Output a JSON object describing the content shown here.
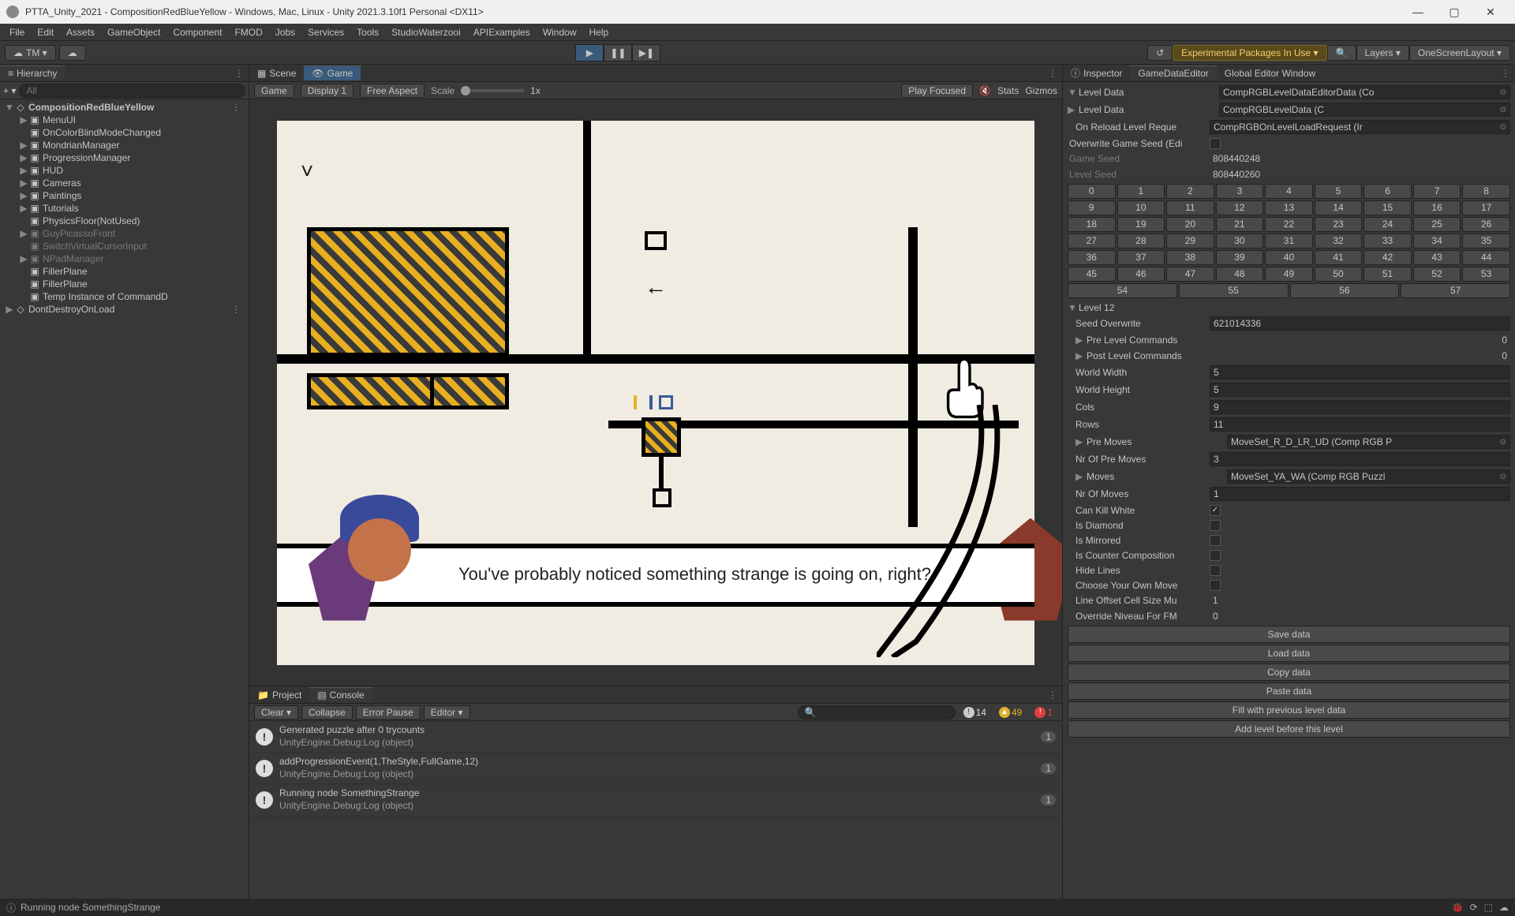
{
  "window": {
    "title": "PTTA_Unity_2021 - CompositionRedBlueYellow - Windows, Mac, Linux - Unity 2021.3.10f1 Personal <DX11>"
  },
  "menubar": [
    "File",
    "Edit",
    "Assets",
    "GameObject",
    "Component",
    "FMOD",
    "Jobs",
    "Services",
    "Tools",
    "StudioWaterzooi",
    "APIExamples",
    "Window",
    "Help"
  ],
  "toolbar": {
    "account": "TM ▾",
    "experimental": "Experimental Packages In Use ▾",
    "layers": "Layers",
    "layout": "OneScreenLayout ▾"
  },
  "hierarchy": {
    "tab": "Hierarchy",
    "search_ph": "All",
    "plus": "+ ▾",
    "items": [
      {
        "label": "CompositionRedBlueYellow",
        "depth": 0,
        "arrow": "▼",
        "bold": true,
        "ctx": true
      },
      {
        "label": "MenuUI",
        "depth": 1,
        "arrow": "▶"
      },
      {
        "label": "OnColorBlindModeChanged",
        "depth": 1,
        "arrow": ""
      },
      {
        "label": "MondrianManager",
        "depth": 1,
        "arrow": "▶"
      },
      {
        "label": "ProgressionManager",
        "depth": 1,
        "arrow": "▶"
      },
      {
        "label": "HUD",
        "depth": 1,
        "arrow": "▶"
      },
      {
        "label": "Cameras",
        "depth": 1,
        "arrow": "▶"
      },
      {
        "label": "Paintings",
        "depth": 1,
        "arrow": "▶"
      },
      {
        "label": "Tutorials",
        "depth": 1,
        "arrow": "▶"
      },
      {
        "label": "PhysicsFloor(NotUsed)",
        "depth": 1,
        "arrow": ""
      },
      {
        "label": "GuyPicassoFront",
        "depth": 1,
        "arrow": "▶",
        "dim": true
      },
      {
        "label": "SwitchVirtualCursorInput",
        "depth": 1,
        "arrow": "",
        "dim": true
      },
      {
        "label": "NPadManager",
        "depth": 1,
        "arrow": "▶",
        "dim": true
      },
      {
        "label": "FillerPlane",
        "depth": 1,
        "arrow": ""
      },
      {
        "label": "FillerPlane",
        "depth": 1,
        "arrow": ""
      },
      {
        "label": "Temp Instance of CommandD",
        "depth": 1,
        "arrow": ""
      },
      {
        "label": "DontDestroyOnLoad",
        "depth": 0,
        "arrow": "▶",
        "bold": false,
        "ctx": true
      }
    ]
  },
  "scenetabs": {
    "scene": "Scene",
    "game": "Game"
  },
  "gametoolbar": {
    "mode": "Game",
    "display": "Display 1",
    "aspect": "Free Aspect",
    "scale": "Scale",
    "scaleval": "1x",
    "playfocused": "Play Focused",
    "stats": "Stats",
    "gizmos": "Gizmos"
  },
  "dialogue": "You've probably noticed something strange is going on, right?",
  "console": {
    "tabs": {
      "project": "Project",
      "console": "Console"
    },
    "buttons": {
      "clear": "Clear ▾",
      "collapse": "Collapse",
      "errorpause": "Error Pause",
      "editor": "Editor ▾"
    },
    "counts": {
      "info": "14",
      "warn": "49",
      "err": "1"
    },
    "logs": [
      {
        "line1": "Generated puzzle after 0 trycounts",
        "line2": "UnityEngine.Debug:Log (object)",
        "count": "1"
      },
      {
        "line1": "addProgressionEvent(1,TheStyle,FullGame,12)",
        "line2": "UnityEngine.Debug:Log (object)",
        "count": "1"
      },
      {
        "line1": "Running node SomethingStrange",
        "line2": "UnityEngine.Debug:Log (object)",
        "count": "1"
      }
    ]
  },
  "insp_tabs": {
    "inspector": "Inspector",
    "gde": "GameDataEditor",
    "gew": "Global Editor Window"
  },
  "insp": {
    "leveldata_hdr": "Level Data",
    "leveldata_hdr_val": "CompRGBLevelDataEditorData (Co",
    "leveldata": "Level Data",
    "leveldata_val": "CompRGBLevelData (C",
    "onreload": "On Reload Level Reque",
    "onreload_val": "CompRGBOnLevelLoadRequest (Ir",
    "overwrite_seed": "Overwrite Game Seed (Edi",
    "game_seed_lbl": "Game Seed",
    "game_seed": "808440248",
    "level_seed_lbl": "Level Seed",
    "level_seed": "808440260",
    "numbers": [
      "0",
      "1",
      "2",
      "3",
      "4",
      "5",
      "6",
      "7",
      "8",
      "9",
      "10",
      "11",
      "12",
      "13",
      "14",
      "15",
      "16",
      "17",
      "18",
      "19",
      "20",
      "21",
      "22",
      "23",
      "24",
      "25",
      "26",
      "27",
      "28",
      "29",
      "30",
      "31",
      "32",
      "33",
      "34",
      "35",
      "36",
      "37",
      "38",
      "39",
      "40",
      "41",
      "42",
      "43",
      "44",
      "45",
      "46",
      "47",
      "48",
      "49",
      "50",
      "51",
      "52",
      "53"
    ],
    "numbers_bottom": [
      "54",
      "55",
      "56",
      "57"
    ],
    "level12": "Level 12",
    "seed_ow_lbl": "Seed Overwrite",
    "seed_ow": "621014336",
    "pre_cmds": "Pre Level Commands",
    "pre_cmds_ct": "0",
    "post_cmds": "Post Level Commands",
    "post_cmds_ct": "0",
    "world_w_lbl": "World Width",
    "world_w": "5",
    "world_h_lbl": "World Height",
    "world_h": "5",
    "cols_lbl": "Cols",
    "cols": "9",
    "rows_lbl": "Rows",
    "rows": "11",
    "pre_moves": "Pre Moves",
    "pre_moves_val": "MoveSet_R_D_LR_UD (Comp RGB P",
    "nr_pre_moves_lbl": "Nr Of Pre Moves",
    "nr_pre_moves": "3",
    "moves": "Moves",
    "moves_val": "MoveSet_YA_WA (Comp RGB Puzzl",
    "nr_moves_lbl": "Nr Of Moves",
    "nr_moves": "1",
    "can_kill": "Can Kill White",
    "is_diamond": "Is Diamond",
    "is_mirrored": "Is Mirrored",
    "is_counter": "Is Counter Composition",
    "hide_lines": "Hide Lines",
    "choose_own": "Choose Your Own Move",
    "line_offset": "Line Offset Cell Size Mu",
    "line_offset_v": "1",
    "override_niv": "Override Niveau For FM",
    "override_niv_v": "0",
    "btn_save": "Save data",
    "btn_load": "Load data",
    "btn_copy": "Copy data",
    "btn_paste": "Paste data",
    "btn_fill": "Fill with previous level data",
    "btn_add": "Add level before this level"
  },
  "status": {
    "text": "Running node SomethingStrange"
  }
}
